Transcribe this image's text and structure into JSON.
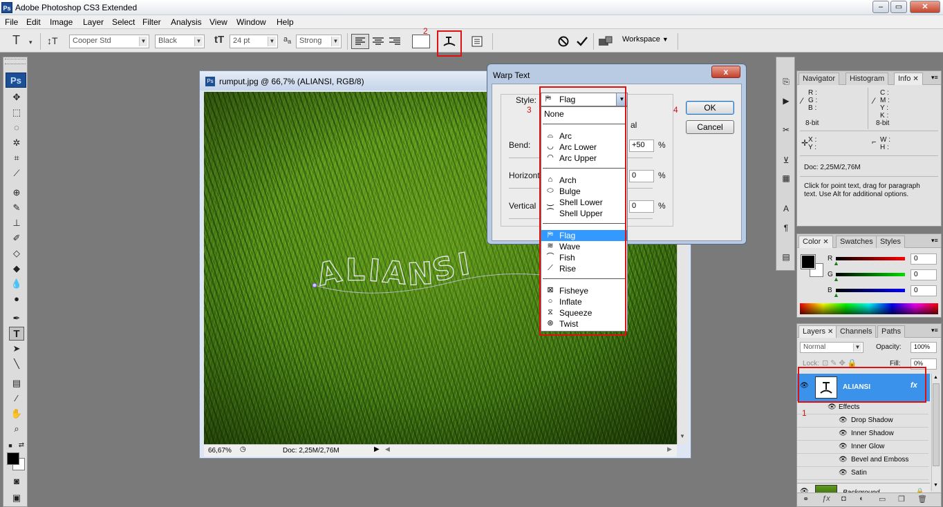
{
  "app": {
    "title": "Adobe Photoshop CS3 Extended",
    "ps_logo": "Ps"
  },
  "menu": [
    "File",
    "Edit",
    "Image",
    "Layer",
    "Select",
    "Filter",
    "Analysis",
    "View",
    "Window",
    "Help"
  ],
  "options": {
    "font_family": "Cooper Std",
    "font_style": "Black",
    "font_size": "24 pt",
    "antialias_label": "a",
    "antialias": "Strong",
    "workspace": "Workspace",
    "annotation_2": "2"
  },
  "document": {
    "title": "rumput.jpg @ 66,7% (ALIANSI, RGB/8)",
    "zoom": "66,67%",
    "doc_size": "Doc: 2,25M/2,76M",
    "warped_text": "ALIANSI"
  },
  "warp_dialog": {
    "title": "Warp Text",
    "close": "x",
    "style_label": "Style:",
    "style_value": "Flag",
    "orientation_fragment": "al",
    "bend_label": "Bend:",
    "bend_value": "+50",
    "horizontal_label": "Horizont",
    "horizontal_value": "0",
    "vertical_label": "Vertical",
    "vertical_value": "0",
    "percent": "%",
    "ok": "OK",
    "cancel": "Cancel",
    "annotation_3": "3",
    "annotation_4": "4",
    "style_options": {
      "none": "None",
      "arc": "Arc",
      "arc_lower": "Arc Lower",
      "arc_upper": "Arc Upper",
      "arch": "Arch",
      "bulge": "Bulge",
      "shell_lower": "Shell Lower",
      "shell_upper": "Shell Upper",
      "flag": "Flag",
      "wave": "Wave",
      "fish": "Fish",
      "rise": "Rise",
      "fisheye": "Fisheye",
      "inflate": "Inflate",
      "squeeze": "Squeeze",
      "twist": "Twist"
    }
  },
  "info_panel": {
    "tabs": {
      "navigator": "Navigator",
      "histogram": "Histogram",
      "info": "Info"
    },
    "r": "R :",
    "g": "G :",
    "b": "B :",
    "c": "C :",
    "m": "M :",
    "y": "Y :",
    "k": "K :",
    "bit_left": "8-bit",
    "bit_right": "8-bit",
    "x": "X :",
    "yy": "Y :",
    "w": "W :",
    "h": "H :",
    "doc": "Doc: 2,25M/2,76M",
    "hint": "Click for point text, drag for paragraph text. Use Alt for additional options."
  },
  "color_panel": {
    "tabs": {
      "color": "Color",
      "swatches": "Swatches",
      "styles": "Styles"
    },
    "r_label": "R",
    "g_label": "G",
    "b_label": "B",
    "r": "0",
    "g": "0",
    "b": "0"
  },
  "layers_panel": {
    "tabs": {
      "layers": "Layers",
      "channels": "Channels",
      "paths": "Paths"
    },
    "blend_mode": "Normal",
    "opacity_label": "Opacity:",
    "opacity": "100%",
    "lock_label": "Lock:",
    "fill_label": "Fill:",
    "fill": "0%",
    "layer_name": "ALIANSI",
    "fx": "fx",
    "annotation_1": "1",
    "effects_label": "Effects",
    "effects": {
      "drop_shadow": "Drop Shadow",
      "inner_shadow": "Inner Shadow",
      "inner_glow": "Inner Glow",
      "bevel": "Bevel and Emboss",
      "satin": "Satin"
    },
    "background_layer": "Background"
  },
  "colors": {
    "selection_blue": "#3399ff",
    "annotation_red": "#e01010",
    "ps_blue": "#1d4f96"
  }
}
